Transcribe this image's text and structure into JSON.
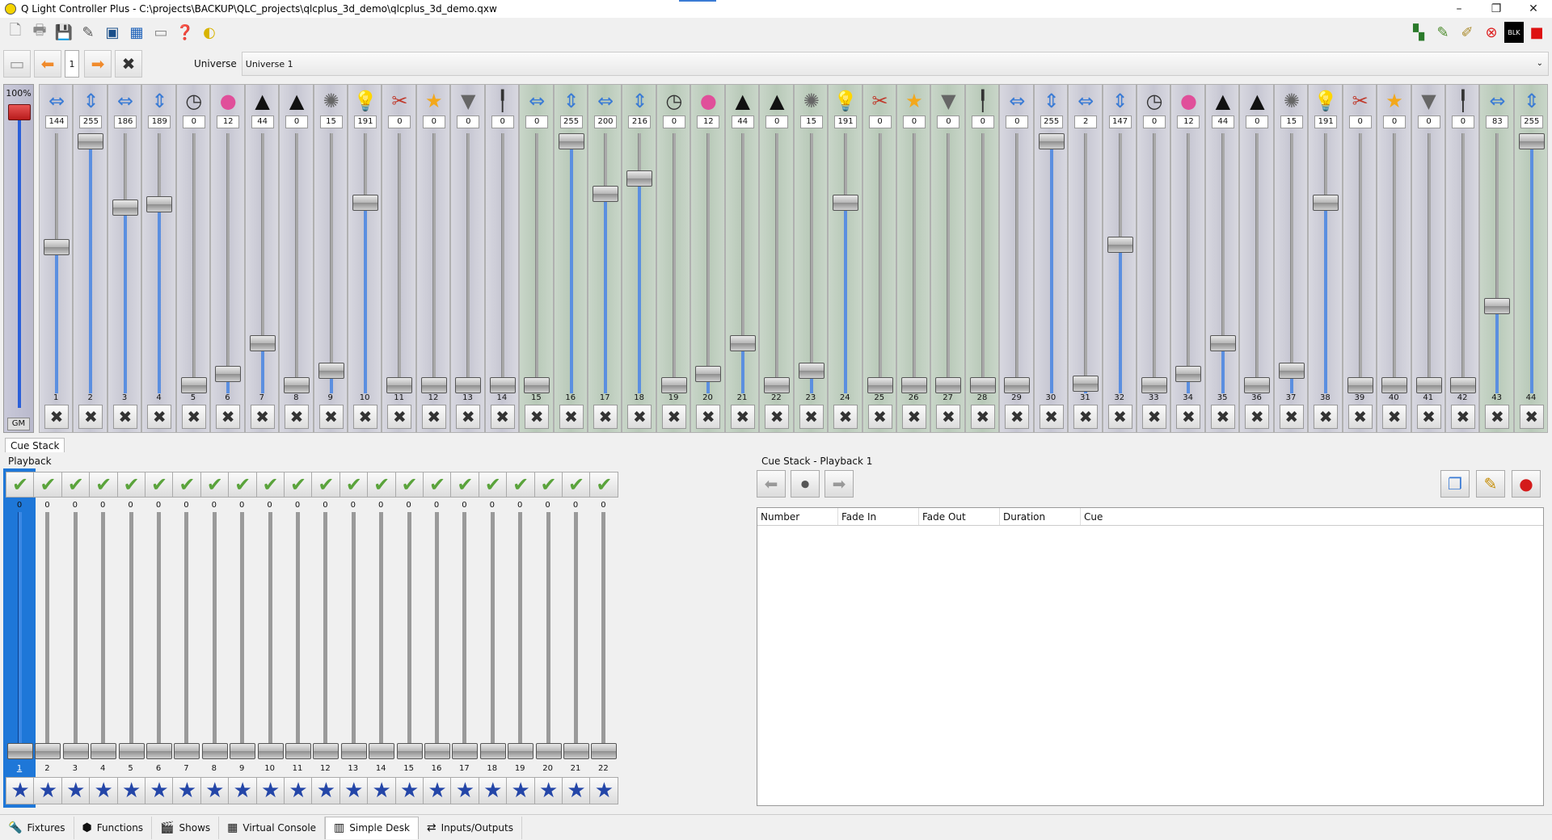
{
  "window": {
    "title": "Q Light Controller Plus - C:\\projects\\BACKUP\\QLC_projects\\qlcplus_3d_demo\\qlcplus_3d_demo.qxw",
    "controls": [
      "–",
      "❐",
      "✕"
    ]
  },
  "universe_bar": {
    "page": "1",
    "label": "Universe",
    "selected": "Universe 1"
  },
  "grand_master": {
    "percent": "100%",
    "label": "GM",
    "level": 1.0
  },
  "channels": [
    {
      "num": "1",
      "value": "144",
      "icon": "pan-icon",
      "glyph": "⇔",
      "color": "#3a7bd5"
    },
    {
      "num": "2",
      "value": "255",
      "icon": "tilt-icon",
      "glyph": "⇕",
      "color": "#3a7bd5"
    },
    {
      "num": "3",
      "value": "186",
      "icon": "pan-icon",
      "glyph": "⇔",
      "color": "#3a7bd5"
    },
    {
      "num": "4",
      "value": "189",
      "icon": "tilt-icon",
      "glyph": "⇕",
      "color": "#3a7bd5"
    },
    {
      "num": "5",
      "value": "0",
      "icon": "speed-icon",
      "glyph": "◷",
      "color": "#333"
    },
    {
      "num": "6",
      "value": "12",
      "icon": "color-wheel-icon",
      "glyph": "●",
      "color": "#e04f9a"
    },
    {
      "num": "7",
      "value": "44",
      "icon": "gobo-icon",
      "glyph": "▲",
      "color": "#111"
    },
    {
      "num": "8",
      "value": "0",
      "icon": "gobo-icon",
      "glyph": "▲",
      "color": "#111"
    },
    {
      "num": "9",
      "value": "15",
      "icon": "shutter-icon",
      "glyph": "✺",
      "color": "#666"
    },
    {
      "num": "10",
      "value": "191",
      "icon": "intensity-icon",
      "glyph": "💡",
      "color": "#e6c200"
    },
    {
      "num": "11",
      "value": "0",
      "icon": "maintenance-icon",
      "glyph": "✂",
      "color": "#c0392b"
    },
    {
      "num": "12",
      "value": "0",
      "icon": "effect-icon",
      "glyph": "★",
      "color": "#f3a81b"
    },
    {
      "num": "13",
      "value": "0",
      "icon": "beam-icon",
      "glyph": "▼",
      "color": "#666"
    },
    {
      "num": "14",
      "value": "0",
      "icon": "focus-icon",
      "glyph": "╿",
      "color": "#333"
    },
    {
      "num": "15",
      "value": "0",
      "icon": "pan-icon",
      "glyph": "⇔",
      "color": "#3a7bd5",
      "green": true
    },
    {
      "num": "16",
      "value": "255",
      "icon": "tilt-icon",
      "glyph": "⇕",
      "color": "#3a7bd5",
      "green": true
    },
    {
      "num": "17",
      "value": "200",
      "icon": "pan-icon",
      "glyph": "⇔",
      "color": "#3a7bd5",
      "green": true
    },
    {
      "num": "18",
      "value": "216",
      "icon": "tilt-icon",
      "glyph": "⇕",
      "color": "#3a7bd5",
      "green": true
    },
    {
      "num": "19",
      "value": "0",
      "icon": "speed-icon",
      "glyph": "◷",
      "color": "#333",
      "green": true
    },
    {
      "num": "20",
      "value": "12",
      "icon": "color-wheel-icon",
      "glyph": "●",
      "color": "#e04f9a",
      "green": true
    },
    {
      "num": "21",
      "value": "44",
      "icon": "gobo-icon",
      "glyph": "▲",
      "color": "#111",
      "green": true
    },
    {
      "num": "22",
      "value": "0",
      "icon": "gobo-icon",
      "glyph": "▲",
      "color": "#111",
      "green": true
    },
    {
      "num": "23",
      "value": "15",
      "icon": "shutter-icon",
      "glyph": "✺",
      "color": "#666",
      "green": true
    },
    {
      "num": "24",
      "value": "191",
      "icon": "intensity-icon",
      "glyph": "💡",
      "color": "#e6c200",
      "green": true
    },
    {
      "num": "25",
      "value": "0",
      "icon": "maintenance-icon",
      "glyph": "✂",
      "color": "#c0392b",
      "green": true
    },
    {
      "num": "26",
      "value": "0",
      "icon": "effect-icon",
      "glyph": "★",
      "color": "#f3a81b",
      "green": true
    },
    {
      "num": "27",
      "value": "0",
      "icon": "beam-icon",
      "glyph": "▼",
      "color": "#666",
      "green": true
    },
    {
      "num": "28",
      "value": "0",
      "icon": "focus-icon",
      "glyph": "╿",
      "color": "#333",
      "green": true
    },
    {
      "num": "29",
      "value": "0",
      "icon": "pan-icon",
      "glyph": "⇔",
      "color": "#3a7bd5"
    },
    {
      "num": "30",
      "value": "255",
      "icon": "tilt-icon",
      "glyph": "⇕",
      "color": "#3a7bd5"
    },
    {
      "num": "31",
      "value": "2",
      "icon": "pan-icon",
      "glyph": "⇔",
      "color": "#3a7bd5"
    },
    {
      "num": "32",
      "value": "147",
      "icon": "tilt-icon",
      "glyph": "⇕",
      "color": "#3a7bd5"
    },
    {
      "num": "33",
      "value": "0",
      "icon": "speed-icon",
      "glyph": "◷",
      "color": "#333"
    },
    {
      "num": "34",
      "value": "12",
      "icon": "color-wheel-icon",
      "glyph": "●",
      "color": "#e04f9a"
    },
    {
      "num": "35",
      "value": "44",
      "icon": "gobo-icon",
      "glyph": "▲",
      "color": "#111"
    },
    {
      "num": "36",
      "value": "0",
      "icon": "gobo-icon",
      "glyph": "▲",
      "color": "#111"
    },
    {
      "num": "37",
      "value": "15",
      "icon": "shutter-icon",
      "glyph": "✺",
      "color": "#666"
    },
    {
      "num": "38",
      "value": "191",
      "icon": "intensity-icon",
      "glyph": "💡",
      "color": "#e6c200"
    },
    {
      "num": "39",
      "value": "0",
      "icon": "maintenance-icon",
      "glyph": "✂",
      "color": "#c0392b"
    },
    {
      "num": "40",
      "value": "0",
      "icon": "effect-icon",
      "glyph": "★",
      "color": "#f3a81b"
    },
    {
      "num": "41",
      "value": "0",
      "icon": "beam-icon",
      "glyph": "▼",
      "color": "#666"
    },
    {
      "num": "42",
      "value": "0",
      "icon": "focus-icon",
      "glyph": "╿",
      "color": "#333"
    },
    {
      "num": "43",
      "value": "83",
      "icon": "pan-icon",
      "glyph": "⇔",
      "color": "#3a7bd5",
      "green": true
    },
    {
      "num": "44",
      "value": "255",
      "icon": "tilt-icon",
      "glyph": "⇕",
      "color": "#3a7bd5",
      "green": true
    }
  ],
  "cue_stack": {
    "tab": "Cue Stack",
    "playback_title": "Playback",
    "panel_title": "Cue Stack - Playback 1",
    "playbacks": [
      {
        "num": "1",
        "value": "0",
        "selected": true
      },
      {
        "num": "2",
        "value": "0"
      },
      {
        "num": "3",
        "value": "0"
      },
      {
        "num": "4",
        "value": "0"
      },
      {
        "num": "5",
        "value": "0"
      },
      {
        "num": "6",
        "value": "0"
      },
      {
        "num": "7",
        "value": "0"
      },
      {
        "num": "8",
        "value": "0"
      },
      {
        "num": "9",
        "value": "0"
      },
      {
        "num": "10",
        "value": "0"
      },
      {
        "num": "11",
        "value": "0"
      },
      {
        "num": "12",
        "value": "0"
      },
      {
        "num": "13",
        "value": "0"
      },
      {
        "num": "14",
        "value": "0"
      },
      {
        "num": "15",
        "value": "0"
      },
      {
        "num": "16",
        "value": "0"
      },
      {
        "num": "17",
        "value": "0"
      },
      {
        "num": "18",
        "value": "0"
      },
      {
        "num": "19",
        "value": "0"
      },
      {
        "num": "20",
        "value": "0"
      },
      {
        "num": "21",
        "value": "0"
      },
      {
        "num": "22",
        "value": "0"
      }
    ],
    "columns": [
      "Number",
      "Fade In",
      "Fade Out",
      "Duration",
      "Cue"
    ]
  },
  "bottom_tabs": [
    {
      "label": "Fixtures",
      "icon": "fixtures-icon",
      "glyph": "🔦"
    },
    {
      "label": "Functions",
      "icon": "functions-icon",
      "glyph": "⬢"
    },
    {
      "label": "Shows",
      "icon": "shows-icon",
      "glyph": "🎬"
    },
    {
      "label": "Virtual Console",
      "icon": "virtual-console-icon",
      "glyph": "▦"
    },
    {
      "label": "Simple Desk",
      "icon": "simple-desk-icon",
      "glyph": "▥",
      "active": true
    },
    {
      "label": "Inputs/Outputs",
      "icon": "inputs-outputs-icon",
      "glyph": "⇄"
    }
  ],
  "colors": {
    "accent_blue": "#1e77d8",
    "fader_fill": "#5b8fe0",
    "green_group": "#b8c9b8",
    "gm_handle": "#d13030"
  }
}
